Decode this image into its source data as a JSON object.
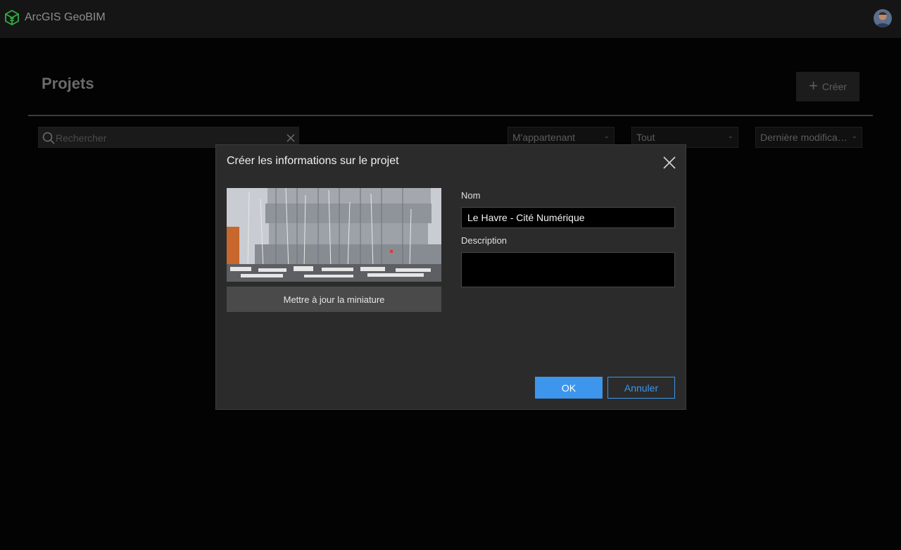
{
  "app": {
    "title": "ArcGIS GeoBIM",
    "logo_icon": "geobim-cube-icon",
    "user_avatar_icon": "user-avatar"
  },
  "page": {
    "title": "Projets",
    "create_button": {
      "label": "Créer",
      "icon": "plus-icon"
    },
    "search": {
      "placeholder": "Rechercher",
      "value": ""
    },
    "filters": {
      "ownership": "M'appartenant",
      "type": "Tout",
      "sort": "Dernière modifica…"
    }
  },
  "dialog": {
    "title": "Créer les informations sur le projet",
    "close_icon": "close-icon",
    "thumbnail_button": "Mettre à jour la miniature",
    "name_label": "Nom",
    "name_value": "Le Havre - Cité Numérique",
    "description_label": "Description",
    "description_value": "",
    "ok_label": "OK",
    "cancel_label": "Annuler"
  },
  "colors": {
    "background": "#030303",
    "topbar": "#151515",
    "dialog": "#2b2b2b",
    "accent": "#3d96ec",
    "logo": "#35ac46"
  }
}
